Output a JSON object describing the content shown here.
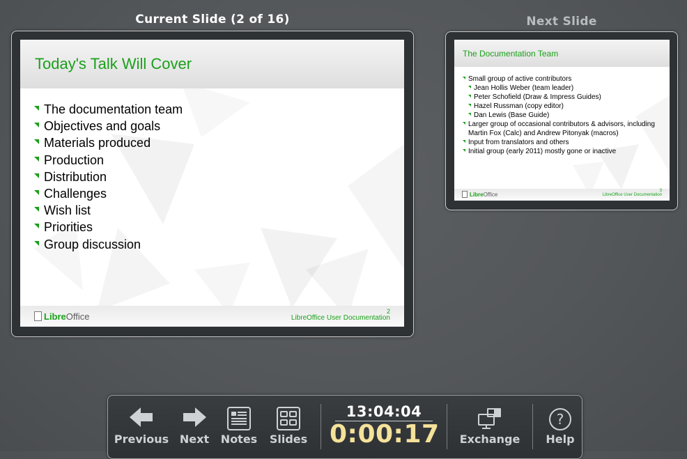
{
  "current_label": "Current Slide (2 of 16)",
  "next_label": "Next Slide",
  "current_slide": {
    "title": "Today's Talk Will Cover",
    "bullets": [
      "The documentation team",
      "Objectives and goals",
      "Materials produced",
      "Production",
      "Distribution",
      "Challenges",
      "Wish list",
      "Priorities",
      "Group discussion"
    ],
    "logo_brand": "Libre",
    "logo_rest": "Office",
    "footer": "LibreOffice User Documentation",
    "page_number": "2"
  },
  "next_slide": {
    "title": "The Documentation Team",
    "bullets": [
      "Small group of active contributors",
      "Jean Hollis Weber (team leader)",
      "Peter Schofield (Draw & Impress Guides)",
      "Hazel Russman (copy editor)",
      "Dan Lewis (Base Guide)",
      "Larger group of occasional contributors & advisors, including Martin Fox (Calc) and Andrew Pitonyak (macros)",
      "Input from translators and others",
      "Initial group (early 2011) mostly gone or inactive"
    ],
    "logo_brand": "Libre",
    "logo_rest": "Office",
    "footer": "LibreOffice User Documentation",
    "page_number": "3"
  },
  "toolbar": {
    "previous": "Previous",
    "next": "Next",
    "notes": "Notes",
    "slides": "Slides",
    "clock": "13:04:04",
    "elapsed": "0:00:17",
    "exchange": "Exchange",
    "help": "Help"
  },
  "icons": {
    "previous": "arrow-left-icon",
    "next": "arrow-right-icon",
    "notes": "notes-icon",
    "slides": "slides-grid-icon",
    "exchange": "exchange-screens-icon",
    "help": "help-icon"
  },
  "colors": {
    "accent_green": "#1aa01a",
    "timer_yellow": "#f5e29a",
    "background": "#54575a"
  }
}
